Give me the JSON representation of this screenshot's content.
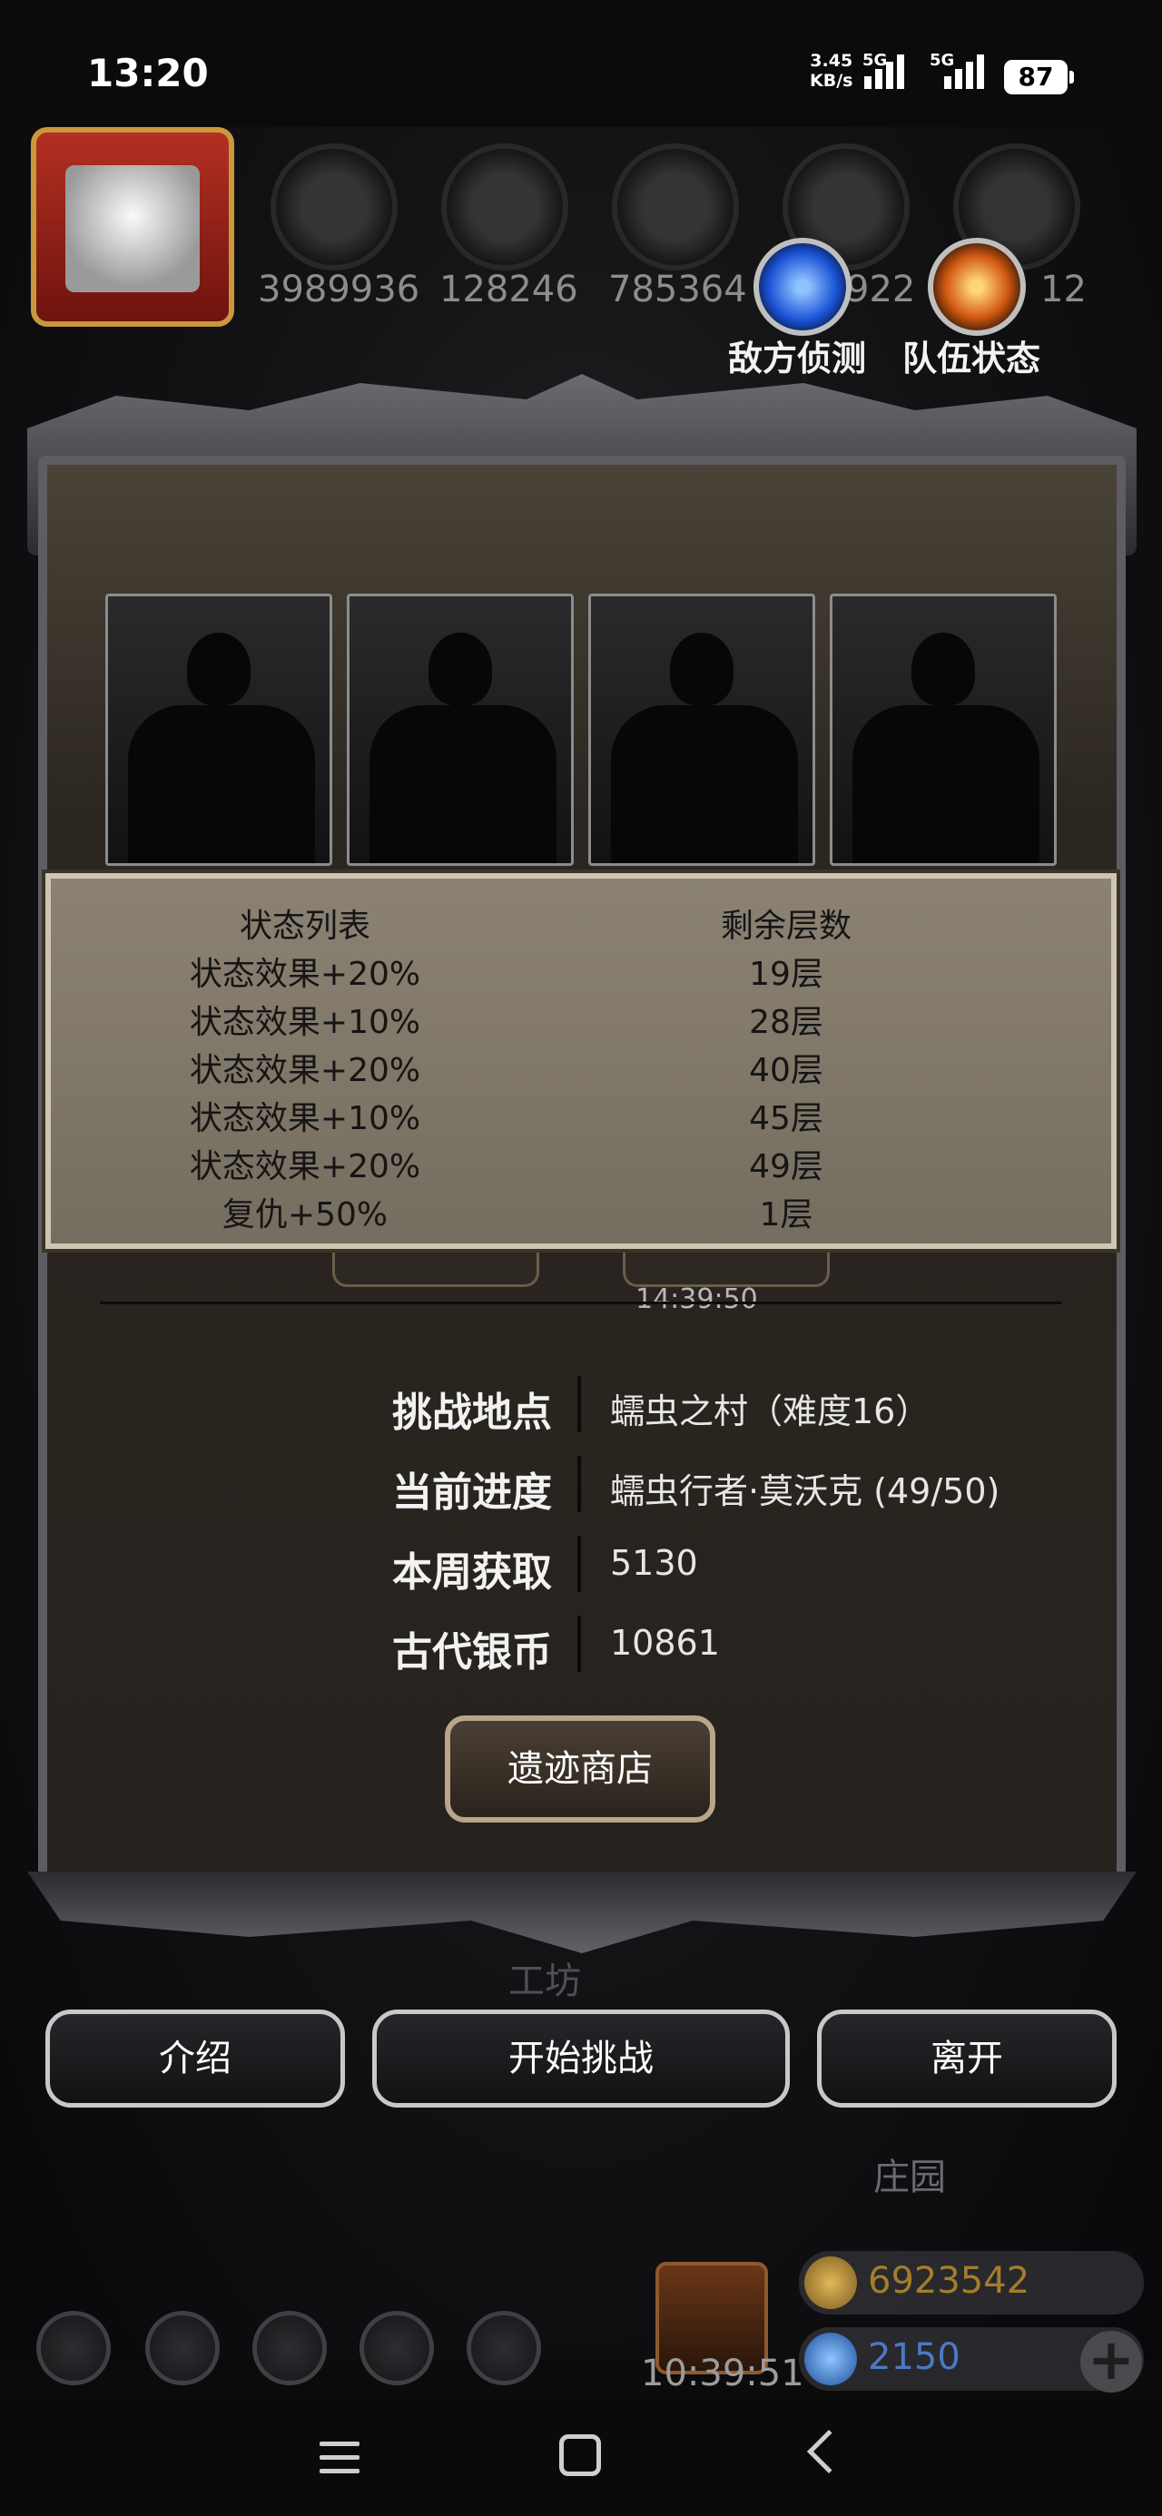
{
  "status_bar": {
    "time": "13:20",
    "speed_value": "3.45",
    "speed_unit": "KB/s",
    "network_1": "5G",
    "network_2": "5G",
    "battery": "87"
  },
  "resources": [
    {
      "icon": "meat-icon",
      "value": "3989936"
    },
    {
      "icon": "wood-icon",
      "value": "128246"
    },
    {
      "icon": "iron-icon",
      "value": "785364"
    },
    {
      "icon": "feather-icon",
      "value": "922"
    },
    {
      "icon": "stone-icon",
      "value": "12"
    }
  ],
  "top_actions": {
    "enemy_scout": "敌方侦测",
    "team_status": "队伍状态"
  },
  "status_panel": {
    "header_left": "状态列表",
    "header_right": "剩余层数",
    "rows": [
      {
        "effect": "状态效果+20%",
        "layers": "19层"
      },
      {
        "effect": "状态效果+10%",
        "layers": "28层"
      },
      {
        "effect": "状态效果+20%",
        "layers": "40层"
      },
      {
        "effect": "状态效果+10%",
        "layers": "45层"
      },
      {
        "effect": "状态效果+20%",
        "layers": "49层"
      },
      {
        "effect": "复仇+50%",
        "layers": "1层"
      }
    ]
  },
  "countdown": "14:39:50",
  "info": {
    "location_label": "挑战地点",
    "location_value": "蠕虫之村（难度16）",
    "progress_label": "当前进度",
    "progress_value": "蠕虫行者·莫沃克 (49/50)",
    "weekly_label": "本周获取",
    "weekly_value": "5130",
    "coin_label": "古代银币",
    "coin_value": "10861"
  },
  "shop_button": "遗迹商店",
  "background_labels": {
    "workshop": "工坊",
    "manor": "庄园"
  },
  "buttons": {
    "intro": "介绍",
    "start": "开始挑战",
    "leave": "离开"
  },
  "hud": {
    "gift_timer": "10:39:51",
    "gold": "6923542",
    "gems": "2150"
  },
  "colors": {
    "panel_bg": "#857c6d",
    "gold_text": "#a57d2a",
    "gem_text": "#4b79c4"
  }
}
